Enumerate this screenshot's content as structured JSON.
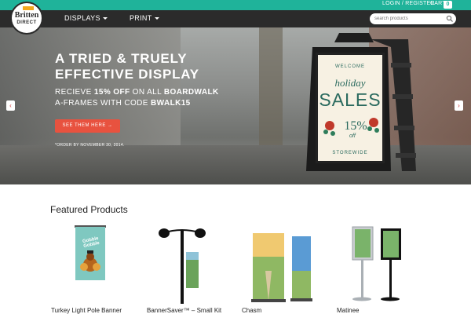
{
  "topbar": {
    "login": "LOGIN / REGISTER",
    "cart": "CART",
    "cart_count": "0"
  },
  "logo": {
    "brand": "Britten",
    "sub": "DIRECT"
  },
  "nav": {
    "items": [
      {
        "label": "DISPLAYS"
      },
      {
        "label": "PRINT"
      }
    ],
    "search_placeholder": "search products"
  },
  "hero": {
    "title_line1": "A TRIED & TRUELY",
    "title_line2": "EFFECTIVE DISPLAY",
    "sub_line1_pre": "RECIEVE ",
    "sub_line1_bold": "15% OFF",
    "sub_line1_mid": " ON ALL ",
    "sub_line1_bold2": "BOARDWALK",
    "sub_line2_pre": "A-FRAMES WITH CODE ",
    "sub_line2_bold": "BWALK15",
    "cta": "SEE THEM HERE →",
    "note": "*ORDER BY NOVEMBER 30, 2014.",
    "sign": {
      "welcome": "WELCOME",
      "holiday": "holiday",
      "sales": "SALES",
      "percent": "15%",
      "off": "off",
      "storewide": "STOREWIDE"
    },
    "prev": "‹",
    "next": "›"
  },
  "featured": {
    "title": "Featured Products",
    "products": [
      {
        "name": "Turkey Light Pole Banner",
        "banner_text": "Gobble Gobble"
      },
      {
        "name": "BannerSaver™ – Small Kit"
      },
      {
        "name": "Chasm"
      },
      {
        "name": "Matinee"
      }
    ]
  },
  "colors": {
    "accent": "#1fb39a",
    "nav_bg": "#2b2b2b",
    "cta": "#e8523f"
  }
}
